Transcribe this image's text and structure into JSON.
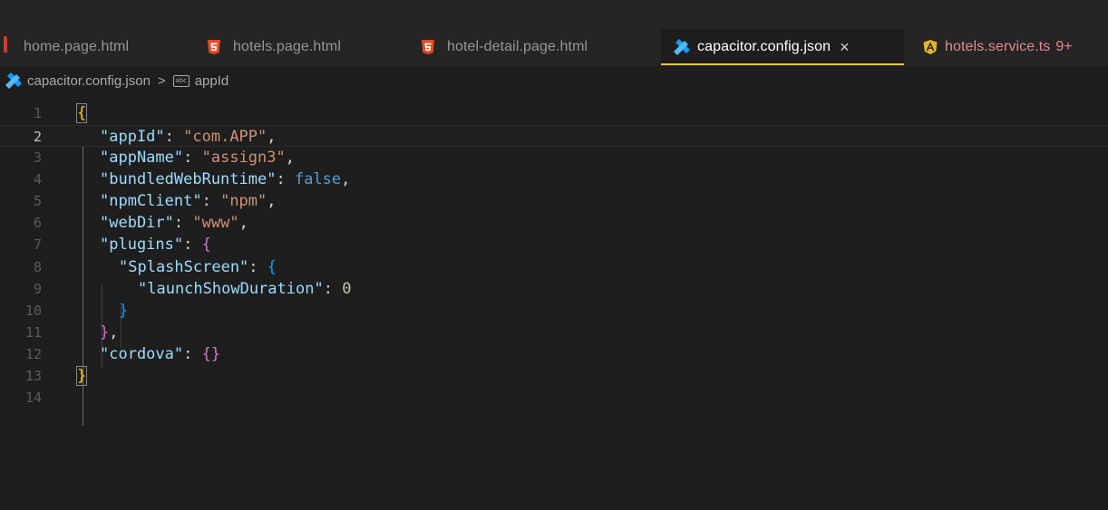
{
  "tabs": [
    {
      "label": "home.page.html",
      "icon": "html5-icon"
    },
    {
      "label": "hotels.page.html",
      "icon": "html5-icon"
    },
    {
      "label": "hotel-detail.page.html",
      "icon": "html5-icon"
    },
    {
      "label": "capacitor.config.json",
      "icon": "capacitor-icon",
      "active": true,
      "close": "×"
    },
    {
      "label": "hotels.service.ts",
      "icon": "angular-icon",
      "problems": "9+"
    }
  ],
  "breadcrumb": {
    "file": "capacitor.config.json",
    "separator": ">",
    "symbol_icon_text": "abc",
    "symbol": "appId"
  },
  "editor": {
    "line_numbers": [
      "1",
      "2",
      "3",
      "4",
      "5",
      "6",
      "7",
      "8",
      "9",
      "10",
      "11",
      "12",
      "13",
      "14"
    ],
    "active_line": "2",
    "lines": {
      "l1": {
        "open": "{"
      },
      "l2": {
        "key": "\"appId\"",
        "colon": ": ",
        "value": "\"com.APP\"",
        "comma": ","
      },
      "l3": {
        "key": "\"appName\"",
        "colon": ": ",
        "value": "\"assign3\"",
        "comma": ","
      },
      "l4": {
        "key": "\"bundledWebRuntime\"",
        "colon": ": ",
        "value": "false",
        "comma": ","
      },
      "l5": {
        "key": "\"npmClient\"",
        "colon": ": ",
        "value": "\"npm\"",
        "comma": ","
      },
      "l6": {
        "key": "\"webDir\"",
        "colon": ": ",
        "value": "\"www\"",
        "comma": ","
      },
      "l7": {
        "key": "\"plugins\"",
        "colon": ": ",
        "open": "{"
      },
      "l8": {
        "key": "\"SplashScreen\"",
        "colon": ": ",
        "open": "{"
      },
      "l9": {
        "key": "\"launchShowDuration\"",
        "colon": ": ",
        "value": "0"
      },
      "l10": {
        "close": "}"
      },
      "l11": {
        "close": "}",
        "comma": ","
      },
      "l12": {
        "key": "\"cordova\"",
        "colon": ": ",
        "value": "{}"
      },
      "l13": {
        "close": "}"
      }
    }
  },
  "colors": {
    "background": "#1e1e1e",
    "tab_bar": "#252526",
    "active_tab_underline": "#e7c547",
    "json_key": "#9cdcfe",
    "json_string": "#ce9178",
    "bracket_level1": "#ffd700",
    "bracket_level2": "#da70d6",
    "bracket_level3": "#179fff"
  }
}
